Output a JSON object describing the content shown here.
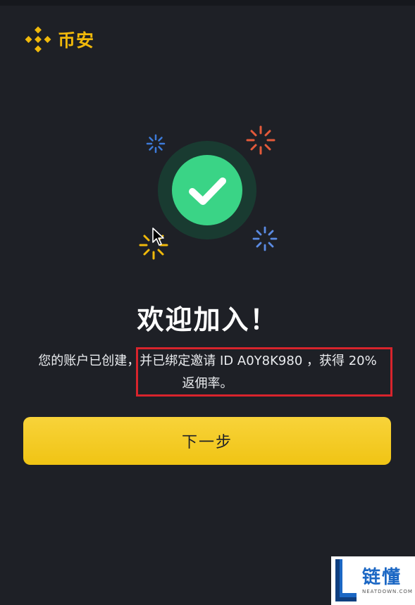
{
  "brand": {
    "name": "币安",
    "color": "#f0b90b"
  },
  "success": {
    "icon": "check-icon",
    "accent": "#3ad486"
  },
  "title": "欢迎加入！",
  "message": {
    "line1": "您的账户已创建，并已绑定邀请 ID A0Y8K980 ，获得 20%",
    "line2": "返佣率。"
  },
  "next_button": {
    "label": "下一步"
  },
  "watermark": {
    "cn": "链懂",
    "en": "NEATDOWN.COM"
  },
  "colors": {
    "background": "#1e2026",
    "button": "#f0c414",
    "highlight": "#d8242c"
  }
}
